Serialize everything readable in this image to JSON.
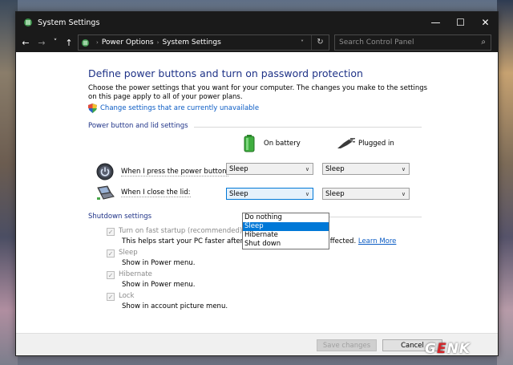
{
  "window": {
    "title": "System Settings",
    "controls": {
      "minimize": "—",
      "maximize": "☐",
      "close": "✕"
    }
  },
  "address": {
    "back": "←",
    "forward": "→",
    "recent": "˅",
    "up": "↑",
    "crumb_sep": "›",
    "breadcrumb": [
      "Power Options",
      "System Settings"
    ],
    "dropdown": "˅",
    "refresh": "↻",
    "search_placeholder": "Search Control Panel",
    "search_icon": "⌕"
  },
  "main": {
    "heading": "Define power buttons and turn on password protection",
    "description": "Choose the power settings that you want for your computer. The changes you make to the settings on this page apply to all of your power plans.",
    "change_link": "Change settings that are currently unavailable",
    "power_group": "Power button and lid settings",
    "col_battery": "On battery",
    "col_plugged": "Plugged in",
    "rows": [
      {
        "label": "When I press the power button:",
        "battery": "Sleep",
        "plugged": "Sleep"
      },
      {
        "label": "When I close the lid:",
        "battery": "Sleep",
        "plugged": "Sleep"
      }
    ],
    "select_arrow": "∨",
    "dropdown_options": [
      "Do nothing",
      "Sleep",
      "Hibernate",
      "Shut down"
    ],
    "dropdown_selected": "Sleep",
    "shutdown_group": "Shutdown settings",
    "shutdown_items": [
      {
        "title": "Turn on fast startup (recommended)",
        "sub": "This helps start your PC faster after shutdown. Restart isn't affected.",
        "link": "Learn More",
        "checked": true
      },
      {
        "title": "Sleep",
        "sub": "Show in Power menu.",
        "checked": true
      },
      {
        "title": "Hibernate",
        "sub": "Show in Power menu.",
        "checked": true
      },
      {
        "title": "Lock",
        "sub": "Show in account picture menu.",
        "checked": true
      }
    ],
    "check_mark": "✓"
  },
  "footer": {
    "save": "Save changes",
    "cancel": "Cancel"
  },
  "watermark": {
    "g": "G",
    "e": "E",
    "nk": "NK"
  },
  "colors": {
    "heading": "#1e3287",
    "link": "#0a5bc4",
    "selection": "#0078d7"
  }
}
